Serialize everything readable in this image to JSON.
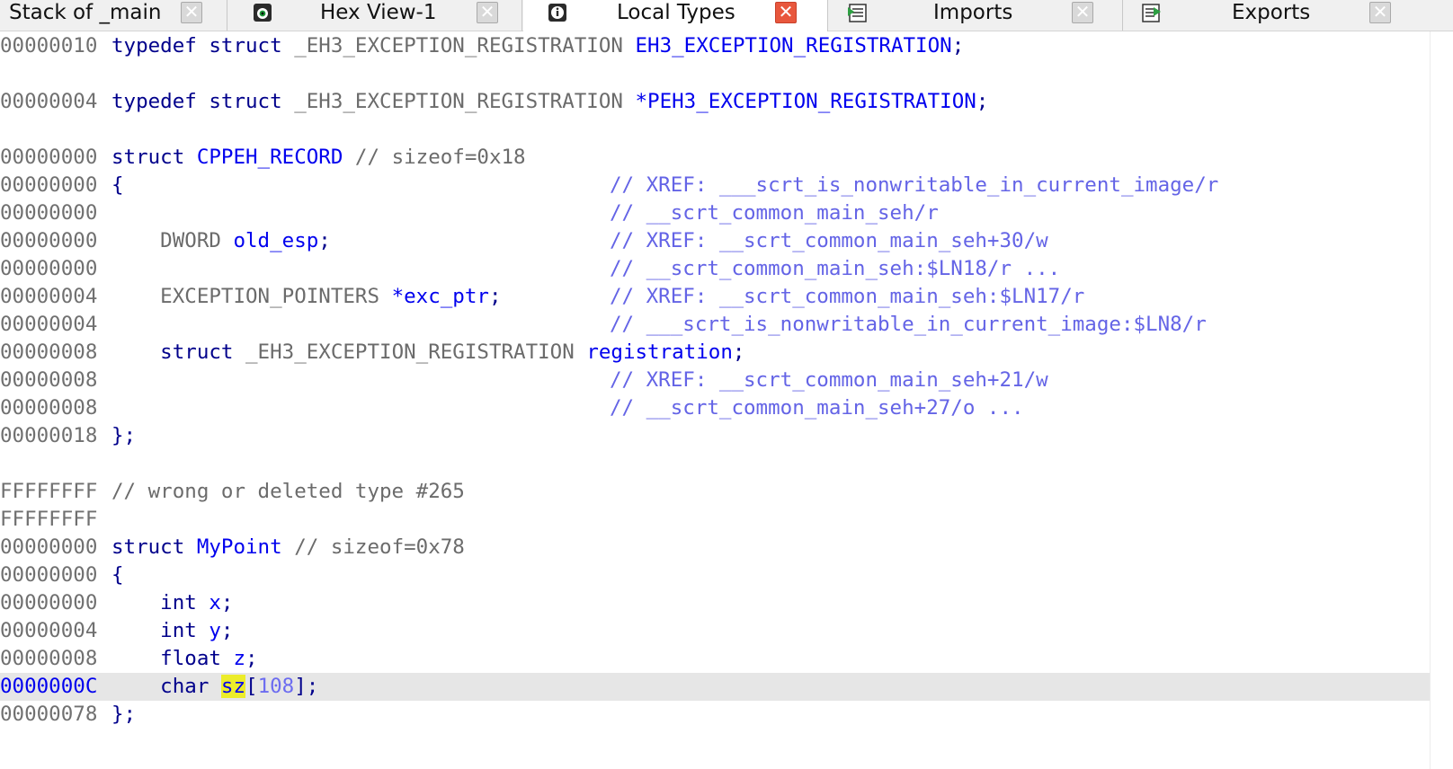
{
  "tabs": [
    {
      "label": "Stack of _main",
      "icon": "none",
      "active": false
    },
    {
      "label": "Hex View-1",
      "icon": "hex-view-icon",
      "active": false
    },
    {
      "label": "Local Types",
      "icon": "info-icon",
      "active": true
    },
    {
      "label": "Imports",
      "icon": "imports-table-icon",
      "active": false
    },
    {
      "label": "Exports",
      "icon": "exports-table-icon",
      "active": false
    }
  ],
  "close_glyph": "✕",
  "colors": {
    "keyword": "#00008b",
    "identifier": "#0000ee",
    "plain_type": "#6b6b6b",
    "xref_comment": "#6464e6",
    "number": "#6c6cf0",
    "highlight": "#ecec2a",
    "current_line": "#e6e6e6",
    "close_active": "#e8573d"
  },
  "code": {
    "l1": {
      "addr": "00000010",
      "kw1": "typedef struct",
      "type": " _EH3_EXCEPTION_REGISTRATION ",
      "name": "EH3_EXCEPTION_REGISTRATION",
      "end": ";"
    },
    "l2": {
      "addr": "00000004",
      "kw1": "typedef struct",
      "type": " _EH3_EXCEPTION_REGISTRATION ",
      "name": "*PEH3_EXCEPTION_REGISTRATION",
      "end": ";"
    },
    "l3": {
      "addr": "00000000",
      "kw1": "struct",
      "name": " CPPEH_RECORD",
      "cmt": " // sizeof=0x18"
    },
    "l4": {
      "addr": "00000000",
      "src": "{",
      "xref": "// XREF: ___scrt_is_nonwritable_in_current_image/r"
    },
    "l5": {
      "addr": "00000000",
      "xref": "// __scrt_common_main_seh/r"
    },
    "l6": {
      "addr": "00000000",
      "type": "    DWORD ",
      "name": "old_esp",
      "end": ";",
      "xref": "// XREF: __scrt_common_main_seh+30/w"
    },
    "l7": {
      "addr": "00000000",
      "xref": "// __scrt_common_main_seh:$LN18/r ..."
    },
    "l8": {
      "addr": "00000004",
      "type": "    EXCEPTION_POINTERS ",
      "name": "*exc_ptr",
      "end": ";",
      "xref": "// XREF: __scrt_common_main_seh:$LN17/r"
    },
    "l9": {
      "addr": "00000004",
      "xref": "// ___scrt_is_nonwritable_in_current_image:$LN8/r"
    },
    "l10": {
      "addr": "00000008",
      "kw1": "    struct",
      "type": " _EH3_EXCEPTION_REGISTRATION ",
      "name": "registration",
      "end": ";"
    },
    "l11": {
      "addr": "00000008",
      "xref": "// XREF: __scrt_common_main_seh+21/w"
    },
    "l12": {
      "addr": "00000008",
      "xref": "// __scrt_common_main_seh+27/o ..."
    },
    "l13": {
      "addr": "00000018",
      "src": "};"
    },
    "l14": {
      "addr": "FFFFFFFF",
      "cmt": "// wrong or deleted type #265"
    },
    "l15": {
      "addr": "FFFFFFFF"
    },
    "l16": {
      "addr": "00000000",
      "kw1": "struct",
      "name": " MyPoint",
      "cmt": " // sizeof=0x78"
    },
    "l17": {
      "addr": "00000000",
      "src": "{"
    },
    "l18": {
      "addr": "00000000",
      "kw1": "    int",
      "name": " x",
      "end": ";"
    },
    "l19": {
      "addr": "00000004",
      "kw1": "    int",
      "name": " y",
      "end": ";"
    },
    "l20": {
      "addr": "00000008",
      "kw1": "    float",
      "name": " z",
      "end": ";"
    },
    "l21": {
      "addr": "0000000C",
      "kw1": "    char ",
      "name": "sz",
      "open": "[",
      "num": "108",
      "close": "];"
    },
    "l22": {
      "addr": "00000078",
      "src": "};"
    }
  }
}
